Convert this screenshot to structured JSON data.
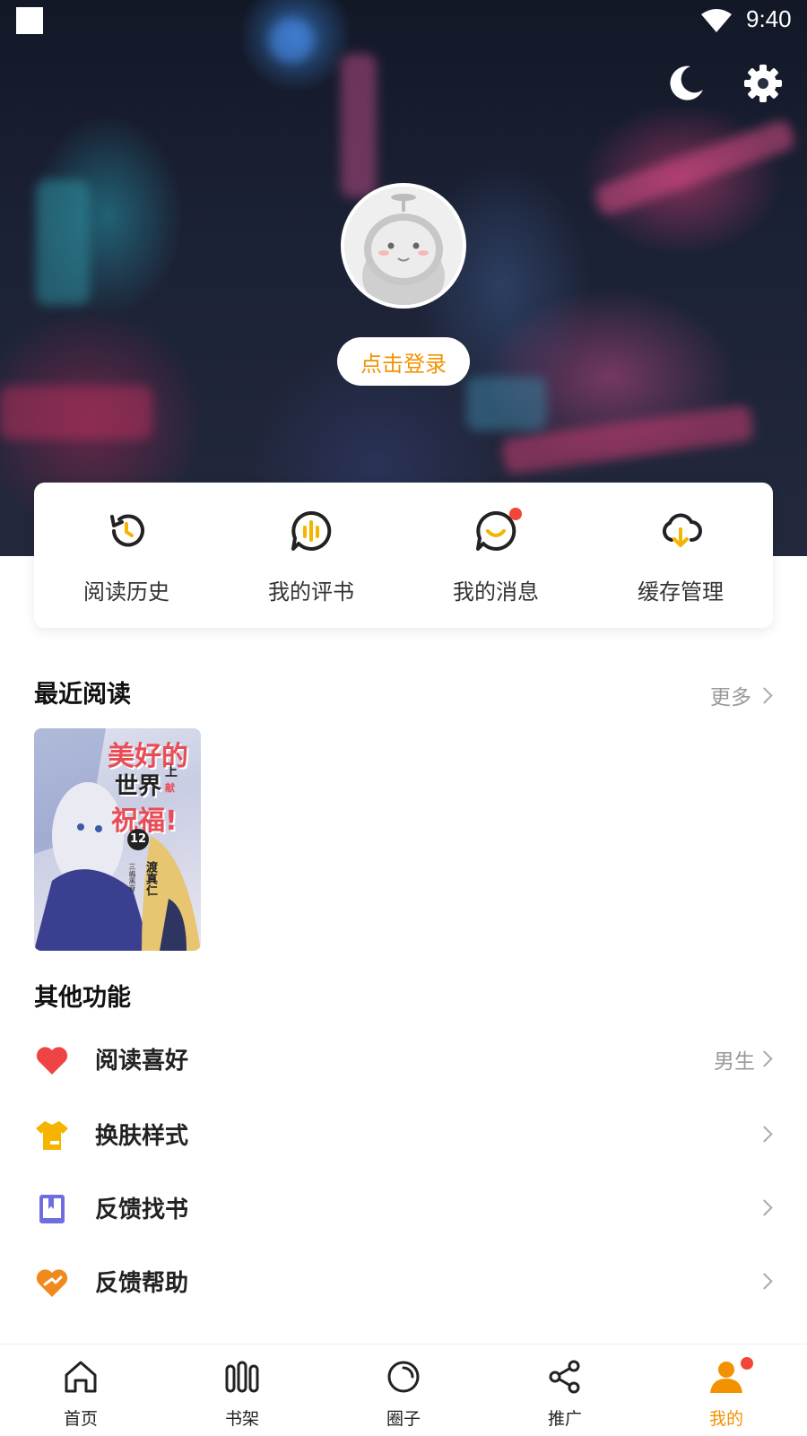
{
  "status_bar": {
    "time": "9:40"
  },
  "header": {
    "login_label": "点击登录"
  },
  "quick_actions": [
    {
      "label": "阅读历史",
      "icon": "history-icon"
    },
    {
      "label": "我的评书",
      "icon": "review-icon"
    },
    {
      "label": "我的消息",
      "icon": "message-icon",
      "badge": true
    },
    {
      "label": "缓存管理",
      "icon": "cloud-download-icon"
    }
  ],
  "recent": {
    "title": "最近阅读",
    "more_label": "更多",
    "book": {
      "cover_text": [
        "美好的",
        "世界",
        "上",
        "献",
        "祝福!"
      ],
      "volume": "12",
      "author": "渡真仁",
      "illustrator": "三嶋黑音"
    }
  },
  "other": {
    "title": "其他功能",
    "items": [
      {
        "label": "阅读喜好",
        "value": "男生",
        "icon": "heart-icon"
      },
      {
        "label": "换肤样式",
        "value": "",
        "icon": "shirt-icon"
      },
      {
        "label": "反馈找书",
        "value": "",
        "icon": "book-icon"
      },
      {
        "label": "反馈帮助",
        "value": "",
        "icon": "help-heart-icon"
      }
    ]
  },
  "bottom_nav": [
    {
      "label": "首页",
      "icon": "home-icon"
    },
    {
      "label": "书架",
      "icon": "bookshelf-icon"
    },
    {
      "label": "圈子",
      "icon": "circle-icon"
    },
    {
      "label": "推广",
      "icon": "share-icon"
    },
    {
      "label": "我的",
      "icon": "user-icon",
      "active": true,
      "badge": true
    }
  ],
  "colors": {
    "accent": "#f39200",
    "badge": "#f2463a"
  }
}
